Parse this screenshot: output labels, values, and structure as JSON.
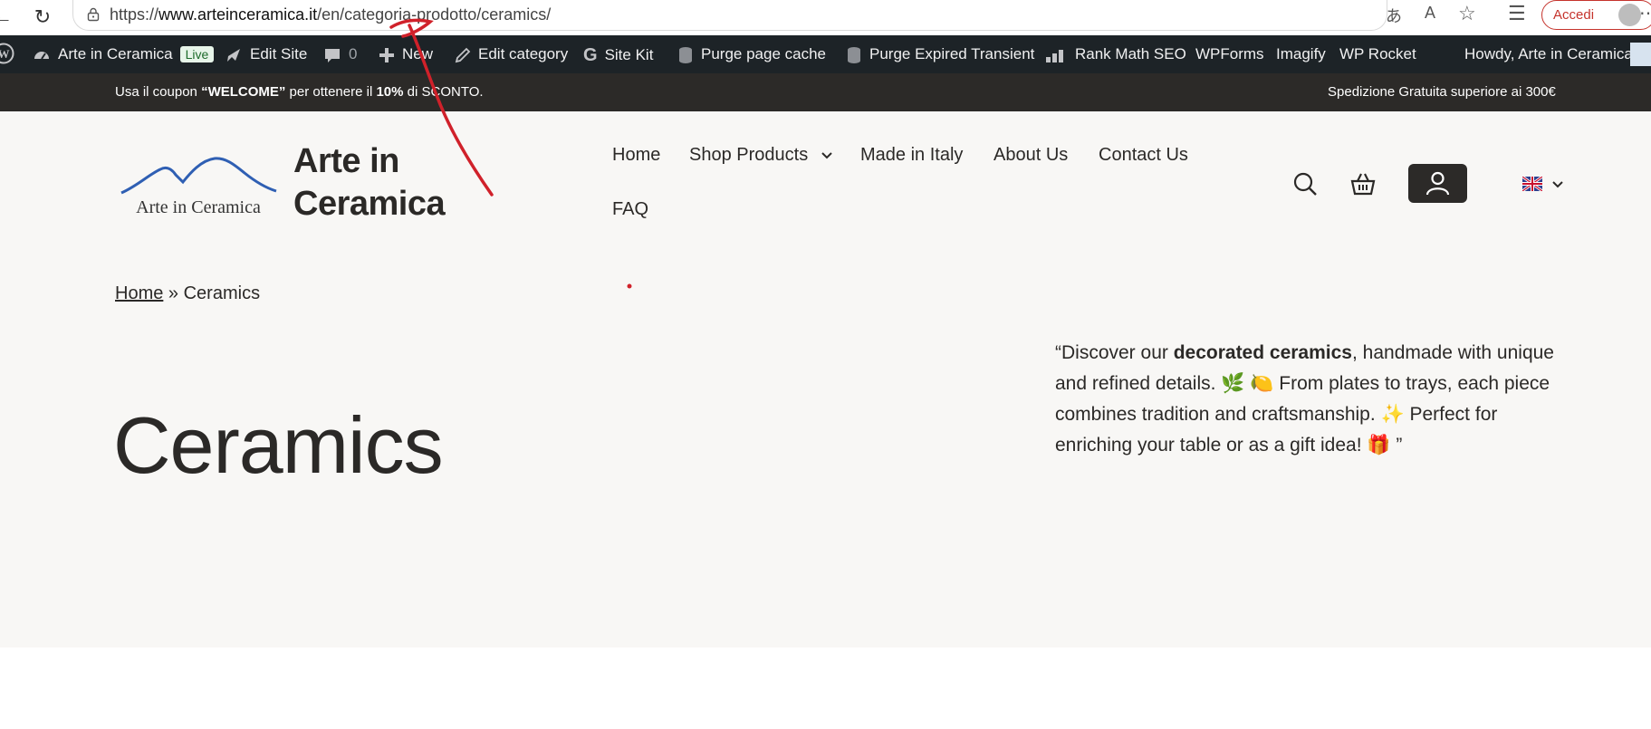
{
  "browser": {
    "url_prefix": "https://",
    "url_host": "www.arteinceramica.it",
    "url_path": "/en/categoria-prodotto/ceramics/",
    "signin_label": "Accedi"
  },
  "admin_bar": {
    "site_name": "Arte in Ceramica",
    "live_badge": "Live",
    "edit_site": "Edit Site",
    "comments_count": "0",
    "new": "New",
    "edit_category": "Edit category",
    "site_kit": "Site Kit",
    "purge_page_cache": "Purge page cache",
    "purge_transient": "Purge Expired Transient",
    "rank_math": "Rank Math SEO",
    "wpforms": "WPForms",
    "imagify": "Imagify",
    "wp_rocket": "WP Rocket",
    "howdy": "Howdy, Arte in Ceramica"
  },
  "notice": {
    "coupon_pre": "Usa il coupon ",
    "coupon_code": "“WELCOME”",
    "coupon_mid": " per ottenere il ",
    "coupon_pct": "10%",
    "coupon_post": " di SCONTO.",
    "shipping": "Spedizione Gratuita superiore ai 300€"
  },
  "header": {
    "logo_text": "Arte in Ceramica",
    "title_line1": "Arte in",
    "title_line2": "Ceramica",
    "menu": {
      "home": "Home",
      "shop": "Shop Products",
      "made_in_italy": "Made in Italy",
      "about": "About Us",
      "contact": "Contact Us",
      "faq": "FAQ"
    }
  },
  "breadcrumb": {
    "home": "Home",
    "separator": " » ",
    "current": "Ceramics"
  },
  "page": {
    "title": "Ceramics",
    "desc_pre": "“Discover our ",
    "desc_bold": "decorated ceramics",
    "desc_post": ", handmade with unique and refined details. 🌿 🍋 From plates to trays, each piece combines tradition and craftsmanship. ✨ Perfect for enriching your table or as a gift idea! 🎁 ”"
  },
  "colors": {
    "admin_bar": "#1d2327",
    "notice_bar": "#2c2a28",
    "site_bg": "#f8f7f5",
    "accent_red": "#d0212a",
    "logo_blue": "#2f5fb3"
  }
}
